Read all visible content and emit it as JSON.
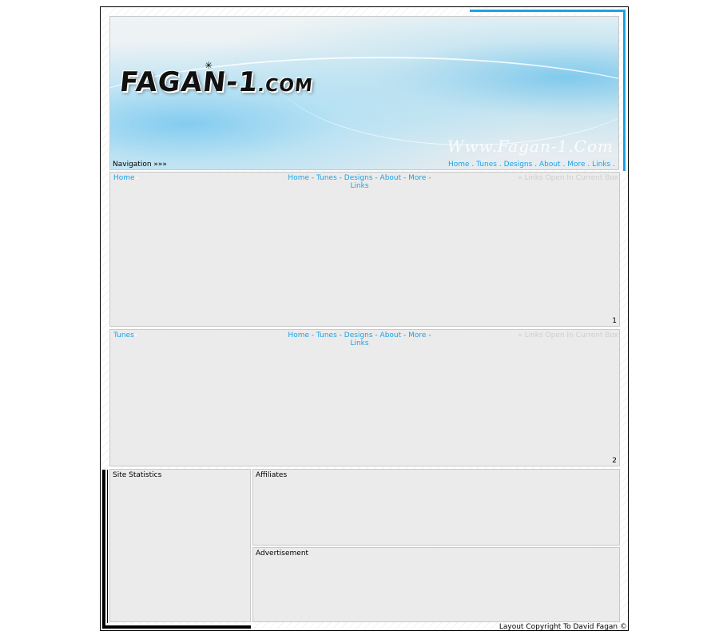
{
  "header": {
    "logo_text": "FAGAN-1",
    "logo_suffix": ".COM",
    "watermark": "Www.Fagan-1.Com",
    "nav_label": "Navigation »»»",
    "links": [
      "Home",
      "Tunes",
      "Designs",
      "About",
      "More",
      "Links"
    ],
    "separator": ".",
    "accent_color": "#1aa3e6"
  },
  "box1": {
    "title": "Home",
    "title_mark": "»",
    "links": [
      "Home",
      "Tunes",
      "Designs",
      "About",
      "More",
      "Links"
    ],
    "separator": "-",
    "note": "« Links Open In Current Box",
    "number": "1"
  },
  "box2": {
    "title": "Tunes",
    "title_mark": "»",
    "links": [
      "Home",
      "Tunes",
      "Designs",
      "About",
      "More",
      "Links"
    ],
    "separator": "-",
    "note": "« Links Open In Current Box",
    "number": "2"
  },
  "stats": {
    "title": "Site Statistics"
  },
  "affiliates": {
    "title": "Affiliates"
  },
  "advertisement": {
    "title": "Advertisement"
  },
  "footer": {
    "copyright": "Layout Copyright To David Fagan ©"
  }
}
